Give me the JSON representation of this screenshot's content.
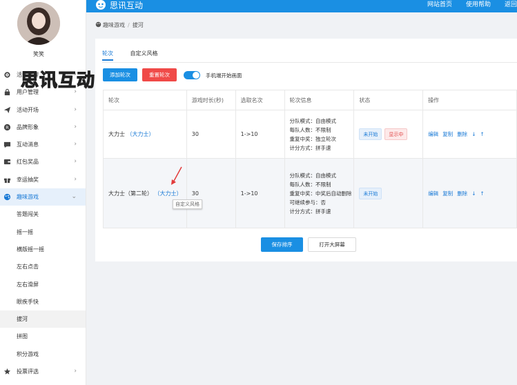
{
  "user": {
    "name": "笑笑"
  },
  "watermark": "思讯互动",
  "topbar": {
    "brand": "思讯互动",
    "nav": [
      "网站首页",
      "使用帮助",
      "返回"
    ]
  },
  "sidebar": {
    "items": [
      {
        "label": "活动管理",
        "icon": "gear-icon"
      },
      {
        "label": "用户管理",
        "icon": "lock-icon"
      },
      {
        "label": "活动开场",
        "icon": "send-icon"
      },
      {
        "label": "品牌形象",
        "icon": "registered-icon"
      },
      {
        "label": "互动消息",
        "icon": "chat-icon"
      },
      {
        "label": "红包奖品",
        "icon": "wallet-icon"
      },
      {
        "label": "幸运抽奖",
        "icon": "gift-icon"
      },
      {
        "label": "趣味游戏",
        "icon": "palette-icon"
      }
    ],
    "sub_items": [
      "答题闯关",
      "摇一摇",
      "横版摇一摇",
      "左右点击",
      "左右滑屏",
      "眼疾手快",
      "拔河",
      "拼图",
      "积分游戏"
    ],
    "bottom_item": {
      "label": "投票评选",
      "icon": "star-icon"
    }
  },
  "breadcrumb": {
    "root": "趣味游戏",
    "sep": "/",
    "current": "拔河"
  },
  "tabs": [
    "轮次",
    "自定义风格"
  ],
  "toolbar": {
    "add": "添加轮次",
    "reset": "重置轮次",
    "switch_label": "手机端开始画面"
  },
  "table": {
    "headers": [
      "轮次",
      "游戏时长(秒)",
      "选取名次",
      "轮次信息",
      "状态",
      "操作"
    ],
    "rows": [
      {
        "name": "大力士",
        "style": "（大力士）",
        "duration": "30",
        "rank": "1->10",
        "info": [
          "分队模式：自由模式",
          "每队人数：不限制",
          "重复中奖：独立轮次",
          "计分方式：拼手速"
        ],
        "tags": [
          "未开始",
          "显示中"
        ]
      },
      {
        "name": "大力士（第二轮）",
        "style": "（大力士）",
        "duration": "30",
        "rank": "1->10",
        "info": [
          "分队模式：自由模式",
          "每队人数：不限制",
          "重复中奖：中奖后自动删除",
          "可继续参与：否",
          "计分方式：拼手速"
        ],
        "tags": [
          "未开始"
        ]
      }
    ],
    "ops": [
      "编辑",
      "复制",
      "删除",
      "↓",
      "↑"
    ]
  },
  "tooltip": "自定义风格",
  "footer": {
    "save": "保存排序",
    "screen": "打开大屏幕"
  },
  "colors": {
    "primary": "#1a8fe3",
    "danger": "#f04a48"
  }
}
